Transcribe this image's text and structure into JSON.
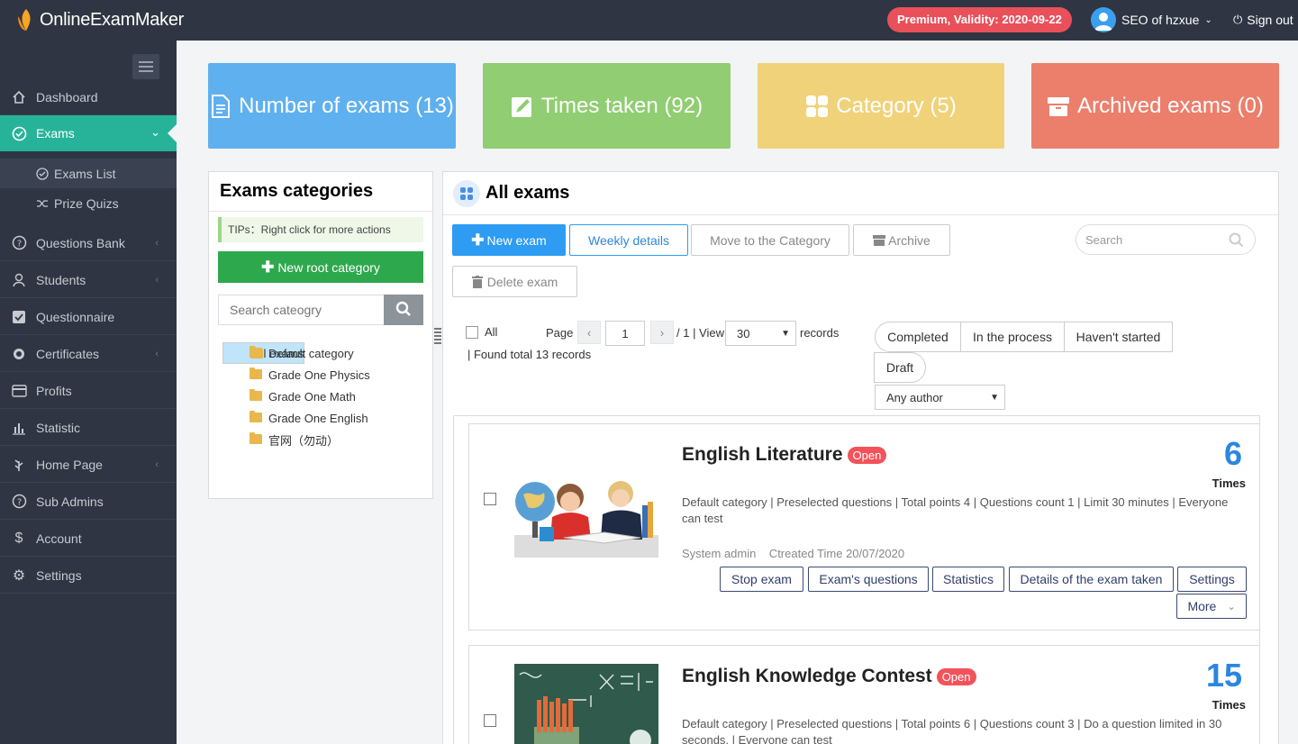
{
  "header": {
    "logo_text": "OnlineExamMaker",
    "premium_badge": "Premium, Validity: 2020-09-22",
    "user_name": "SEO of hzxue",
    "sign_out": "Sign out"
  },
  "sidebar": {
    "items": [
      {
        "label": "Dashboard",
        "icon": "dashboard-icon"
      },
      {
        "label": "Exams",
        "icon": "check-circle-icon"
      },
      {
        "label": "Questions Bank",
        "icon": "question-icon"
      },
      {
        "label": "Students",
        "icon": "users-icon"
      },
      {
        "label": "Questionnaire",
        "icon": "checkbox-icon"
      },
      {
        "label": "Certificates",
        "icon": "certificate-icon"
      },
      {
        "label": "Profits",
        "icon": "card-icon"
      },
      {
        "label": "Statistic",
        "icon": "bar-chart-icon"
      },
      {
        "label": "Home Page",
        "icon": "leaf-icon"
      },
      {
        "label": "Sub Admins",
        "icon": "question-icon"
      },
      {
        "label": "Account",
        "icon": "dollar-icon"
      },
      {
        "label": "Settings",
        "icon": "gear-icon"
      }
    ],
    "sub_items": [
      {
        "label": "Exams List"
      },
      {
        "label": "Prize Quizs"
      }
    ]
  },
  "stats": [
    {
      "label": "Number of exams (13)",
      "color": "#5fb0ef"
    },
    {
      "label": "Times taken (92)",
      "color": "#91cd72"
    },
    {
      "label": "Category (5)",
      "color": "#f0d27a"
    },
    {
      "label": "Archived exams (0)",
      "color": "#ec7f6c"
    }
  ],
  "categories": {
    "title": "Exams categories",
    "tips": "TIPs：Right click for more actions",
    "new_root": "New root category",
    "search_placeholder": "Search cateogry",
    "tree": [
      "All exams",
      "Default category",
      "Grade One Physics",
      "Grade One Math",
      "Grade One English",
      "官网（勿动）"
    ]
  },
  "main": {
    "title": "All exams",
    "buttons": {
      "new_exam": "New exam",
      "weekly": "Weekly details",
      "move": "Move to the Category",
      "archive": "Archive",
      "delete": "Delete exam"
    },
    "search_placeholder": "Search",
    "pager": {
      "all": "All",
      "page": "Page",
      "page_value": "1",
      "of": "/ 1 | View",
      "per_page": "30",
      "records": "records",
      "found": "| Found total 13 records"
    },
    "filters": [
      "Completed",
      "In the process",
      "Haven't started",
      "Draft"
    ],
    "author_select": "Any author"
  },
  "exams": [
    {
      "title": "English Literature",
      "status": "Open",
      "count": "6",
      "count_label": "Times",
      "meta": "Default category | Preselected questions | Total points 4 | Questions count 1 | Limit 30 minutes | Everyone can test",
      "author": "System admin    Ctreated Time 20/07/2020",
      "actions": [
        "Stop exam",
        "Exam's questions",
        "Statistics",
        "Details of the exam taken",
        "Settings"
      ],
      "more": "More"
    },
    {
      "title": "English Knowledge Contest",
      "status": "Open",
      "count": "15",
      "count_label": "Times",
      "meta": "Default category | Preselected questions | Total points 6 | Questions count 3 | Do a question limited in 30 seconds. | Everyone can test"
    }
  ]
}
